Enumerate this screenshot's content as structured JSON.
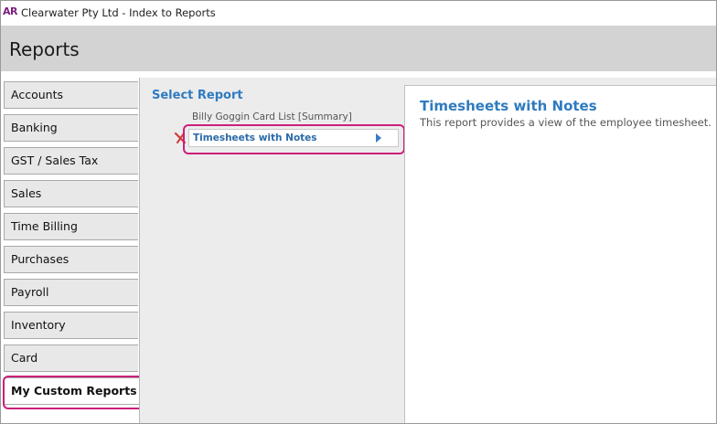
{
  "window": {
    "app_badge": "AR",
    "title": "Clearwater Pty Ltd - Index to Reports"
  },
  "header": {
    "title": "Reports"
  },
  "tabs": [
    {
      "label": "Accounts"
    },
    {
      "label": "Banking"
    },
    {
      "label": "GST / Sales Tax"
    },
    {
      "label": "Sales"
    },
    {
      "label": "Time Billing"
    },
    {
      "label": "Purchases"
    },
    {
      "label": "Payroll"
    },
    {
      "label": "Inventory"
    },
    {
      "label": "Card"
    },
    {
      "label": "My Custom Reports",
      "active": true
    }
  ],
  "select_report": {
    "heading": "Select Report",
    "items": [
      {
        "label": "Billy Goggin Card List [Summary]"
      },
      {
        "label": "Timesheets with Notes",
        "selected": true
      }
    ]
  },
  "detail": {
    "title": "Timesheets with Notes",
    "description": "This report provides a view of the employee timesheet."
  },
  "colors": {
    "accent_blue": "#2f7bbf",
    "highlight_pink": "#cc1f7a",
    "header_gray": "#d3d3d3",
    "delete_red": "#d23b3b"
  }
}
